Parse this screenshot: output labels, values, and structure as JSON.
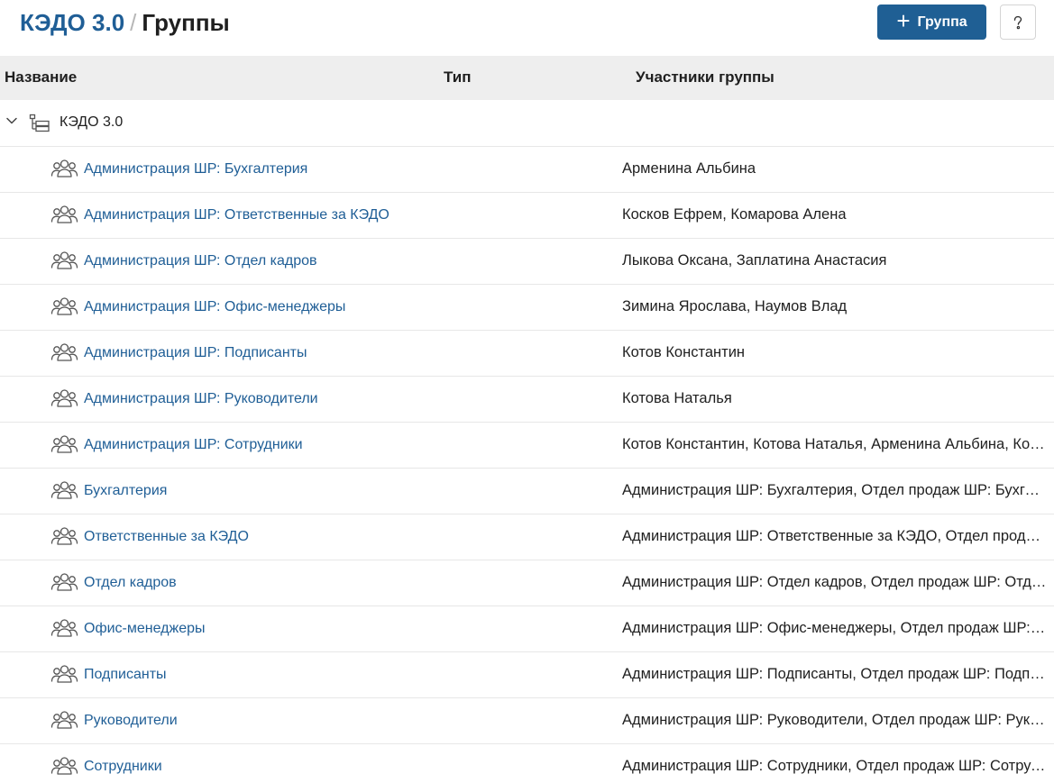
{
  "header": {
    "app_name": "КЭДО 3.0",
    "separator": "/",
    "page_title": "Группы",
    "add_button_label": "Группа",
    "add_button_icon": "plus-icon",
    "help_icon": "help-icon"
  },
  "table": {
    "columns": [
      "Название",
      "Тип",
      "Участники группы"
    ],
    "root": {
      "label": "КЭДО 3.0",
      "icon": "org-structure-icon",
      "expanded": true
    },
    "groups": [
      {
        "name": "Администрация ШР: Бухгалтерия",
        "members": "Арменина Альбина"
      },
      {
        "name": "Администрация ШР: Ответственные за КЭДО",
        "members": "Косков Ефрем, Комарова Алена"
      },
      {
        "name": "Администрация ШР: Отдел кадров",
        "members": "Лыкова Оксана, Заплатина Анастасия"
      },
      {
        "name": "Администрация ШР: Офис-менеджеры",
        "members": "Зимина Ярослава, Наумов Влад"
      },
      {
        "name": "Администрация ШР: Подписанты",
        "members": "Котов Константин"
      },
      {
        "name": "Администрация ШР: Руководители",
        "members": "Котова Наталья"
      },
      {
        "name": "Администрация ШР: Сотрудники",
        "members": "Котов Константин, Котова Наталья, Арменина Альбина, Косков Ефрем"
      },
      {
        "name": "Бухгалтерия",
        "members": "Администрация ШР: Бухгалтерия, Отдел продаж ШР: Бухгалтерия"
      },
      {
        "name": "Ответственные за КЭДО",
        "members": "Администрация ШР: Ответственные за КЭДО, Отдел продаж ШР: Ответственные за КЭДО"
      },
      {
        "name": "Отдел кадров",
        "members": "Администрация ШР: Отдел кадров, Отдел продаж ШР: Отдел кадров"
      },
      {
        "name": "Офис-менеджеры",
        "members": "Администрация ШР: Офис-менеджеры, Отдел продаж ШР: Офис-менеджеры"
      },
      {
        "name": "Подписанты",
        "members": "Администрация ШР: Подписанты, Отдел продаж ШР: Подписанты"
      },
      {
        "name": "Руководители",
        "members": "Администрация ШР: Руководители, Отдел продаж ШР: Руководители"
      },
      {
        "name": "Сотрудники",
        "members": "Администрация ШР: Сотрудники, Отдел продаж ШР: Сотрудники"
      }
    ]
  },
  "colors": {
    "accent": "#1f5f94",
    "link": "#1f5e96",
    "header_bg": "#eeeeee"
  }
}
